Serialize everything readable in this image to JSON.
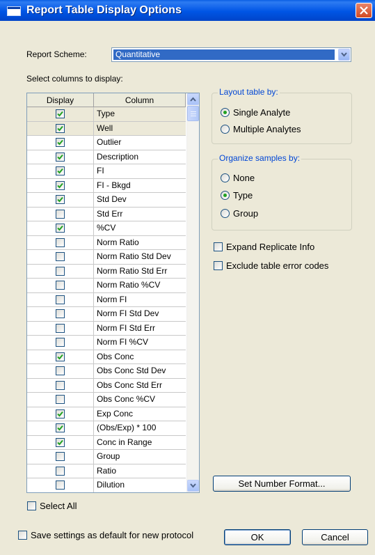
{
  "window": {
    "title": "Report Table Display Options"
  },
  "scheme": {
    "label": "Report Scheme:",
    "value": "Quantitative"
  },
  "columns_label": "Select columns to display:",
  "table": {
    "headers": [
      "Display",
      "Column"
    ],
    "rows": [
      {
        "column": "Type",
        "checked": true
      },
      {
        "column": "Well",
        "checked": true
      },
      {
        "column": "Outlier",
        "checked": true
      },
      {
        "column": "Description",
        "checked": true
      },
      {
        "column": "FI",
        "checked": true
      },
      {
        "column": "FI - Bkgd",
        "checked": true
      },
      {
        "column": "Std Dev",
        "checked": true
      },
      {
        "column": "Std Err",
        "checked": false
      },
      {
        "column": "%CV",
        "checked": true
      },
      {
        "column": "Norm Ratio",
        "checked": false
      },
      {
        "column": "Norm Ratio Std Dev",
        "checked": false
      },
      {
        "column": "Norm Ratio Std Err",
        "checked": false
      },
      {
        "column": "Norm Ratio %CV",
        "checked": false
      },
      {
        "column": "Norm FI",
        "checked": false
      },
      {
        "column": "Norm FI Std Dev",
        "checked": false
      },
      {
        "column": "Norm FI Std Err",
        "checked": false
      },
      {
        "column": "Norm FI %CV",
        "checked": false
      },
      {
        "column": "Obs Conc",
        "checked": true
      },
      {
        "column": "Obs Conc Std Dev",
        "checked": false
      },
      {
        "column": "Obs Conc Std Err",
        "checked": false
      },
      {
        "column": "Obs Conc %CV",
        "checked": false
      },
      {
        "column": "Exp Conc",
        "checked": true
      },
      {
        "column": "(Obs/Exp) * 100",
        "checked": true
      },
      {
        "column": "Conc in Range",
        "checked": true
      },
      {
        "column": "Group",
        "checked": false
      },
      {
        "column": "Ratio",
        "checked": false
      },
      {
        "column": "Dilution",
        "checked": false
      }
    ]
  },
  "layout_group": {
    "title": "Layout table by:",
    "options": [
      {
        "label": "Single Analyte",
        "selected": true
      },
      {
        "label": "Multiple Analytes",
        "selected": false
      }
    ]
  },
  "organize_group": {
    "title": "Organize samples by:",
    "options": [
      {
        "label": "None",
        "selected": false
      },
      {
        "label": "Type",
        "selected": true
      },
      {
        "label": "Group",
        "selected": false
      }
    ]
  },
  "expand_replicate": {
    "label": "Expand Replicate Info",
    "checked": false
  },
  "exclude_errors": {
    "label": "Exclude table error codes",
    "checked": false
  },
  "set_number_format": "Set Number Format...",
  "select_all": {
    "label": "Select All",
    "checked": false
  },
  "save_default": {
    "label": "Save settings as default for new protocol",
    "checked": false
  },
  "ok": "OK",
  "cancel": "Cancel",
  "colors": {
    "titlebar": "#0055E5",
    "check": "#21A121",
    "selection": "#316AC5",
    "group_title": "#0046D5",
    "dialog_bg": "#ECE9D8"
  }
}
